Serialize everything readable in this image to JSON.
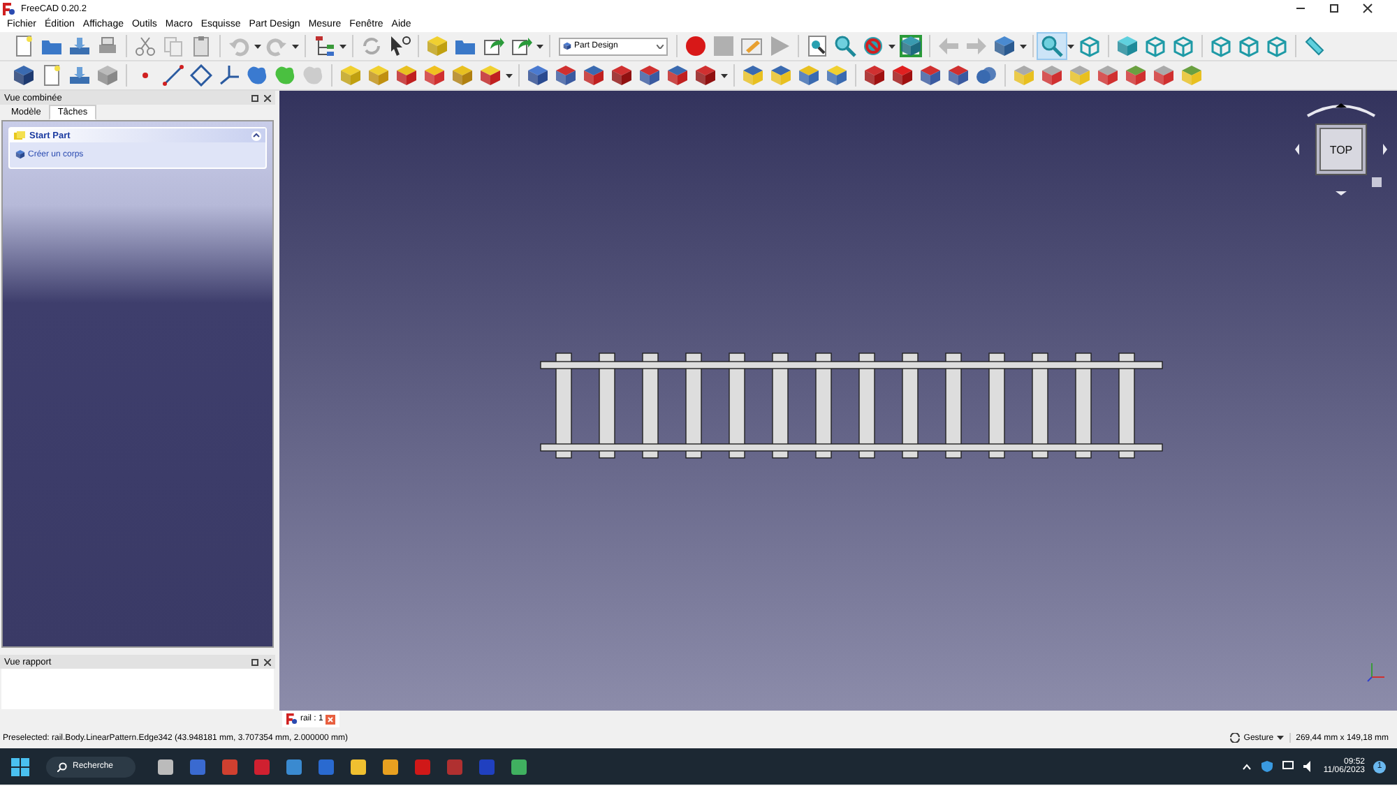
{
  "window": {
    "title": "FreeCAD 0.20.2"
  },
  "menu": [
    "Fichier",
    "Édition",
    "Affichage",
    "Outils",
    "Macro",
    "Esquisse",
    "Part Design",
    "Mesure",
    "Fenêtre",
    "Aide"
  ],
  "workbench_selector": {
    "value": "Part Design"
  },
  "combo_view": {
    "title": "Vue combinée",
    "tabs": [
      {
        "label": "Modèle",
        "selected": false
      },
      {
        "label": "Tâches",
        "selected": true
      }
    ],
    "task_panel": {
      "title": "Start Part",
      "actions": [
        "Créer un corps"
      ]
    }
  },
  "report_view": {
    "title": "Vue rapport"
  },
  "viewport": {
    "nav_cube_face": "TOP"
  },
  "document_tabs": [
    {
      "label": "rail : 1",
      "selected": true
    }
  ],
  "status_bar": {
    "message": "Preselected: rail.Body.LinearPattern.Edge342 (43.948181 mm, 3.707354 mm, 2.000000 mm)",
    "navigation_style": "Gesture",
    "dimensions": "269,44 mm x 149,18 mm"
  },
  "taskbar": {
    "search": "Recherche",
    "time": "09:52",
    "date": "11/06/2023",
    "notification_count": "1"
  }
}
